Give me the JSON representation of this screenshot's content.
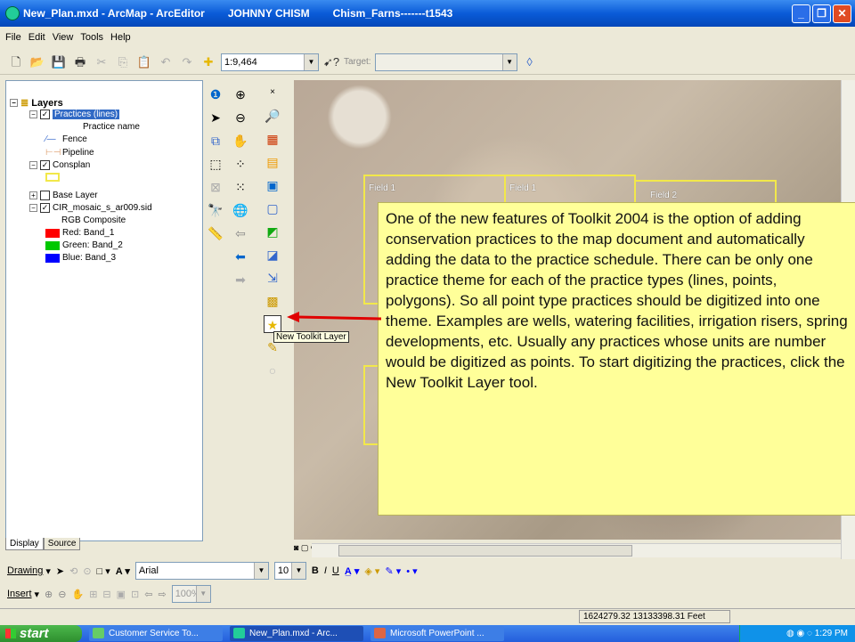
{
  "window": {
    "title": "New_Plan.mxd - ArcMap - ArcEditor",
    "user": "JOHNNY CHISM",
    "farm": "Chism_Farns-------t1543"
  },
  "menu": [
    "File",
    "Edit",
    "View",
    "Tools",
    "Help"
  ],
  "toolbar": {
    "scale": "1:9,464",
    "target_label": "Target:",
    "target_value": ""
  },
  "toc": {
    "root": "Layers",
    "items": [
      {
        "label": "Practices (lines)"
      },
      {
        "label": "Practice name"
      },
      {
        "label": "Fence"
      },
      {
        "label": "Pipeline"
      },
      {
        "label": "Consplan"
      },
      {
        "label": "Base Layer"
      },
      {
        "label": "CIR_mosaic_s_ar009.sid"
      },
      {
        "label": "RGB Composite"
      },
      {
        "label": "Red:  Band_1",
        "color": "#ff0000"
      },
      {
        "label": "Green: Band_2",
        "color": "#00c800"
      },
      {
        "label": "Blue:  Band_3",
        "color": "#0000ff"
      }
    ],
    "tabs": [
      "Display",
      "Source"
    ]
  },
  "map": {
    "fields": [
      "Field 1",
      "Field 1",
      "Field 2"
    ]
  },
  "callout": {
    "text": "One of the new features of Toolkit 2004 is the option of adding conservation practices to the map document and automatically adding the data to the practice schedule. There can be only one practice theme for each of the practice types (lines, points, polygons). So all point type practices should be digitized into one theme. Examples are  wells, watering facilities, irrigation risers, spring developments, etc. Usually any practices whose units are number would be digitized as points. To start digitizing the practices, click the New Toolkit Layer tool."
  },
  "tooltip": "New Toolkit Layer",
  "drawing_toolbar": {
    "drawing_label": "Drawing",
    "font": "Arial",
    "size": "10",
    "insert_label": "Insert",
    "zoom": "100%"
  },
  "status": {
    "coords": "1624279.32  13133398.31 Feet"
  },
  "taskbar": {
    "start": "start",
    "tasks": [
      "Customer Service To...",
      "New_Plan.mxd - Arc...",
      "Microsoft PowerPoint ..."
    ],
    "time": "1:29 PM"
  },
  "colors": {
    "accent": "#316ac5",
    "callout_bg": "#ffff99",
    "field_outline": "#f2e84a"
  }
}
